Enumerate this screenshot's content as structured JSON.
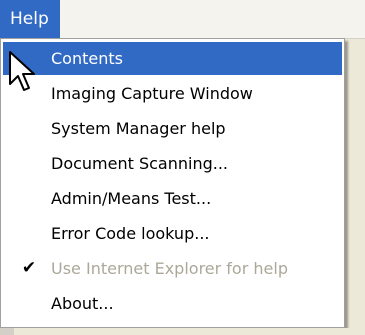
{
  "menubar": {
    "help_label": "Help"
  },
  "help_menu": {
    "items": [
      {
        "label": "Contents"
      },
      {
        "label": "Imaging Capture Window"
      },
      {
        "label": "System Manager help"
      },
      {
        "label": "Document Scanning..."
      },
      {
        "label": "Admin/Means Test..."
      },
      {
        "label": "Error Code lookup..."
      },
      {
        "label": "Use Internet Explorer for help",
        "checked": true,
        "enabled": false
      },
      {
        "label": "About..."
      }
    ],
    "selected_index": 0
  },
  "colors": {
    "highlight": "#316ac5",
    "highlight_text": "#ffffff",
    "disabled_text": "#aca899"
  },
  "icons": {
    "check": "check-icon",
    "cursor": "mouse-pointer-icon"
  }
}
